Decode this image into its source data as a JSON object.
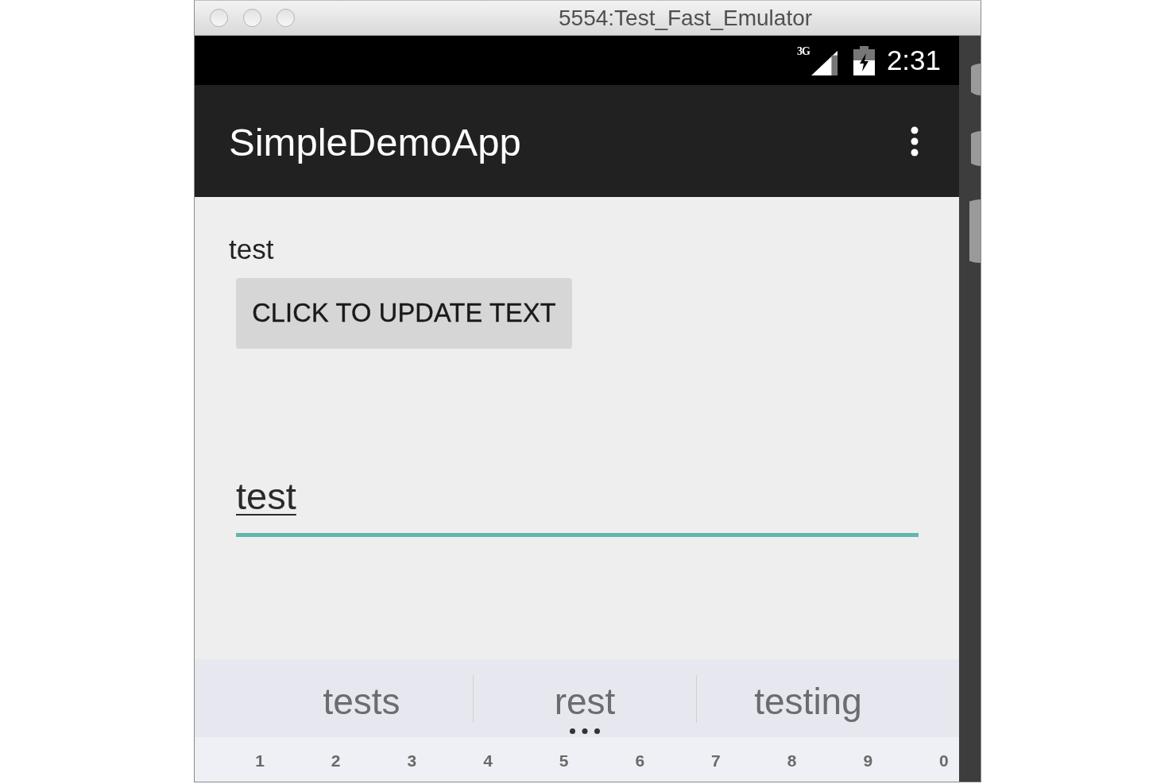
{
  "window": {
    "title": "5554:Test_Fast_Emulator"
  },
  "status_bar": {
    "network": "3G",
    "time": "2:31"
  },
  "app_bar": {
    "title": "SimpleDemoApp"
  },
  "content": {
    "label": "test",
    "button": "CLICK TO UPDATE TEXT",
    "text_field": {
      "value": "test",
      "focused": true,
      "composing": true
    }
  },
  "keyboard": {
    "suggestions": [
      {
        "word": "tests",
        "has_more": false
      },
      {
        "word": "rest",
        "has_more": true
      },
      {
        "word": "testing",
        "has_more": false
      }
    ],
    "number_keys": [
      "1",
      "2",
      "3",
      "4",
      "5",
      "6",
      "7",
      "8",
      "9",
      "0"
    ]
  }
}
